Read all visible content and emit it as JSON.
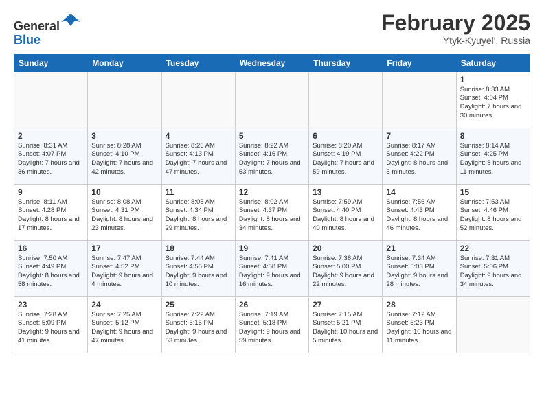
{
  "header": {
    "logo_line1": "General",
    "logo_line2": "Blue",
    "month_title": "February 2025",
    "location": "Ytyk-Kyuyel', Russia"
  },
  "weekdays": [
    "Sunday",
    "Monday",
    "Tuesday",
    "Wednesday",
    "Thursday",
    "Friday",
    "Saturday"
  ],
  "weeks": [
    [
      {
        "day": "",
        "info": ""
      },
      {
        "day": "",
        "info": ""
      },
      {
        "day": "",
        "info": ""
      },
      {
        "day": "",
        "info": ""
      },
      {
        "day": "",
        "info": ""
      },
      {
        "day": "",
        "info": ""
      },
      {
        "day": "1",
        "info": "Sunrise: 8:33 AM\nSunset: 4:04 PM\nDaylight: 7 hours\nand 30 minutes."
      }
    ],
    [
      {
        "day": "2",
        "info": "Sunrise: 8:31 AM\nSunset: 4:07 PM\nDaylight: 7 hours\nand 36 minutes."
      },
      {
        "day": "3",
        "info": "Sunrise: 8:28 AM\nSunset: 4:10 PM\nDaylight: 7 hours\nand 42 minutes."
      },
      {
        "day": "4",
        "info": "Sunrise: 8:25 AM\nSunset: 4:13 PM\nDaylight: 7 hours\nand 47 minutes."
      },
      {
        "day": "5",
        "info": "Sunrise: 8:22 AM\nSunset: 4:16 PM\nDaylight: 7 hours\nand 53 minutes."
      },
      {
        "day": "6",
        "info": "Sunrise: 8:20 AM\nSunset: 4:19 PM\nDaylight: 7 hours\nand 59 minutes."
      },
      {
        "day": "7",
        "info": "Sunrise: 8:17 AM\nSunset: 4:22 PM\nDaylight: 8 hours\nand 5 minutes."
      },
      {
        "day": "8",
        "info": "Sunrise: 8:14 AM\nSunset: 4:25 PM\nDaylight: 8 hours\nand 11 minutes."
      }
    ],
    [
      {
        "day": "9",
        "info": "Sunrise: 8:11 AM\nSunset: 4:28 PM\nDaylight: 8 hours\nand 17 minutes."
      },
      {
        "day": "10",
        "info": "Sunrise: 8:08 AM\nSunset: 4:31 PM\nDaylight: 8 hours\nand 23 minutes."
      },
      {
        "day": "11",
        "info": "Sunrise: 8:05 AM\nSunset: 4:34 PM\nDaylight: 8 hours\nand 29 minutes."
      },
      {
        "day": "12",
        "info": "Sunrise: 8:02 AM\nSunset: 4:37 PM\nDaylight: 8 hours\nand 34 minutes."
      },
      {
        "day": "13",
        "info": "Sunrise: 7:59 AM\nSunset: 4:40 PM\nDaylight: 8 hours\nand 40 minutes."
      },
      {
        "day": "14",
        "info": "Sunrise: 7:56 AM\nSunset: 4:43 PM\nDaylight: 8 hours\nand 46 minutes."
      },
      {
        "day": "15",
        "info": "Sunrise: 7:53 AM\nSunset: 4:46 PM\nDaylight: 8 hours\nand 52 minutes."
      }
    ],
    [
      {
        "day": "16",
        "info": "Sunrise: 7:50 AM\nSunset: 4:49 PM\nDaylight: 8 hours\nand 58 minutes."
      },
      {
        "day": "17",
        "info": "Sunrise: 7:47 AM\nSunset: 4:52 PM\nDaylight: 9 hours\nand 4 minutes."
      },
      {
        "day": "18",
        "info": "Sunrise: 7:44 AM\nSunset: 4:55 PM\nDaylight: 9 hours\nand 10 minutes."
      },
      {
        "day": "19",
        "info": "Sunrise: 7:41 AM\nSunset: 4:58 PM\nDaylight: 9 hours\nand 16 minutes."
      },
      {
        "day": "20",
        "info": "Sunrise: 7:38 AM\nSunset: 5:00 PM\nDaylight: 9 hours\nand 22 minutes."
      },
      {
        "day": "21",
        "info": "Sunrise: 7:34 AM\nSunset: 5:03 PM\nDaylight: 9 hours\nand 28 minutes."
      },
      {
        "day": "22",
        "info": "Sunrise: 7:31 AM\nSunset: 5:06 PM\nDaylight: 9 hours\nand 34 minutes."
      }
    ],
    [
      {
        "day": "23",
        "info": "Sunrise: 7:28 AM\nSunset: 5:09 PM\nDaylight: 9 hours\nand 41 minutes."
      },
      {
        "day": "24",
        "info": "Sunrise: 7:25 AM\nSunset: 5:12 PM\nDaylight: 9 hours\nand 47 minutes."
      },
      {
        "day": "25",
        "info": "Sunrise: 7:22 AM\nSunset: 5:15 PM\nDaylight: 9 hours\nand 53 minutes."
      },
      {
        "day": "26",
        "info": "Sunrise: 7:19 AM\nSunset: 5:18 PM\nDaylight: 9 hours\nand 59 minutes."
      },
      {
        "day": "27",
        "info": "Sunrise: 7:15 AM\nSunset: 5:21 PM\nDaylight: 10 hours\nand 5 minutes."
      },
      {
        "day": "28",
        "info": "Sunrise: 7:12 AM\nSunset: 5:23 PM\nDaylight: 10 hours\nand 11 minutes."
      },
      {
        "day": "",
        "info": ""
      }
    ]
  ]
}
